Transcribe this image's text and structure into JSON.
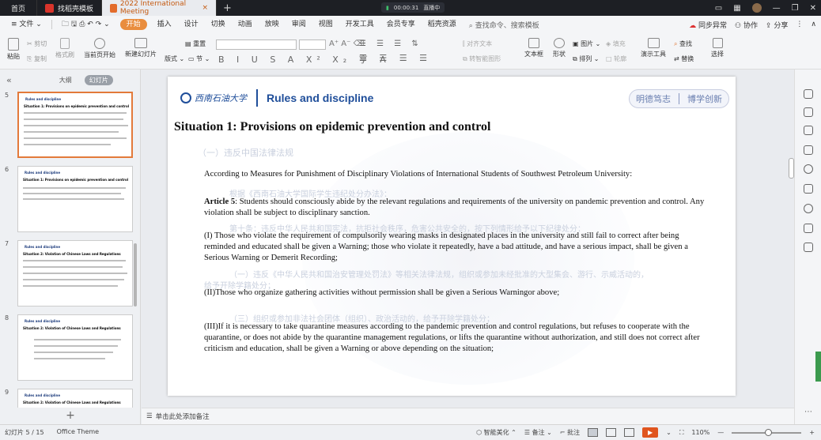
{
  "tabs": {
    "home": "首页",
    "template": "找稻壳模板",
    "doc": "2022 International Meeting",
    "recording_time": "00:00:31",
    "recording_status": "直播中"
  },
  "menu": {
    "file": "文件",
    "start": "开始",
    "items": [
      "插入",
      "设计",
      "切换",
      "动画",
      "放映",
      "审阅",
      "视图",
      "开发工具",
      "会员专享",
      "稻壳资源"
    ],
    "search": "查找命令、搜索模板",
    "sync": "同步异常",
    "collab": "协作",
    "share": "分享"
  },
  "ribbon": {
    "paste": "粘贴",
    "cut": "剪切",
    "copy": "复制",
    "format_painter": "格式刷",
    "play_from_current": "当前页开始",
    "new_slide": "新建幻灯片",
    "layout": "版式",
    "section": "节",
    "reset": "重置",
    "textbox": "文本框",
    "shape": "形状",
    "picture": "图片",
    "arrange": "排列",
    "fill": "填充",
    "outline": "轮廓",
    "presentation_tools": "演示工具",
    "find": "查找",
    "replace": "替换",
    "select": "选择",
    "text_direction": "对齐文本",
    "smartart": "转智能图形"
  },
  "left_pane": {
    "outline_tab": "大纲",
    "slides_tab": "幻灯片",
    "slide_numbers": [
      "5",
      "6",
      "7",
      "8",
      "9"
    ],
    "thumb_titles": [
      "Rules and discipline",
      "Rules and discipline",
      "Rules and discipline",
      "Rules and discipline",
      "Rules and discipline"
    ],
    "thumb_headings": [
      "Situation 1: Provisions on epidemic prevention and control",
      "Situation 1: Provisions on epidemic prevention and control",
      "Situation 2: Violation of Chinese Laws and Regulations",
      "Situation 2: Violation of Chinese Laws and Regulations",
      "Situation 2: Violation of Chinese Laws and Regulations"
    ]
  },
  "slide": {
    "logo_text": "西南石油大学",
    "title": "Rules and discipline",
    "motto_left": "明德笃志",
    "motto_right": "博学创新",
    "heading": "Situation 1: Provisions on epidemic prevention and control",
    "faint_1": "（一）违反中国法律法规",
    "faint_2": "根据《西南石油大学国际学生违纪处分办法》：",
    "faint_3": "第十条：违反中华人民共和国宪法，抗拒社会秩序，危害公共安全的，按下列情形给予以下纪律处分：",
    "faint_4": "（一）违反《中华人民共和国治安管理处罚法》等相关法律法规，组织或参加未经批准的大型集会、游行、示威活动的，",
    "faint_5": "给予开除学籍处分；",
    "faint_6": "（三）组织或参加非法社会团体（组织）、政治活动的，给予开除学籍处分；",
    "p1": "According to Measures for Punishment of  Disciplinary Violations of International Students of Southwest Petroleum University:",
    "p2_bold": "Article 5",
    "p2": ": Students should consciously abide by the relevant regulations and requirements of the university on pandemic prevention and control. Any violation shall be subject to disciplinary sanction.",
    "p3": "(I) Those who violate the requirement of compulsorily wearing masks in designated places in the university and still fail to correct after being reminded and educated shall be given a Warning; those who violate it repeatedly, have a bad attitude, and have a serious impact, shall be given a Serious Warning or Demerit Recording;",
    "p4": "(II)Those who organize gathering activities without permission shall be given a Serious Warningor above;",
    "p5": "(III)If it is necessary to take quarantine measures according to the pandemic prevention and control regulations, but refuses to cooperate with the quarantine, or does not abide by the quarantine management regulations, or lifts the quarantine without authorization, and still does not correct after criticism and education, shall be given a Warning or above depending on the situation;"
  },
  "notes_placeholder": "单击此处添加备注",
  "status": {
    "slide_counter": "幻灯片 5 / 15",
    "theme": "Office Theme",
    "beautify": "智能美化",
    "notes": "备注",
    "comments": "批注",
    "zoom": "110%"
  }
}
